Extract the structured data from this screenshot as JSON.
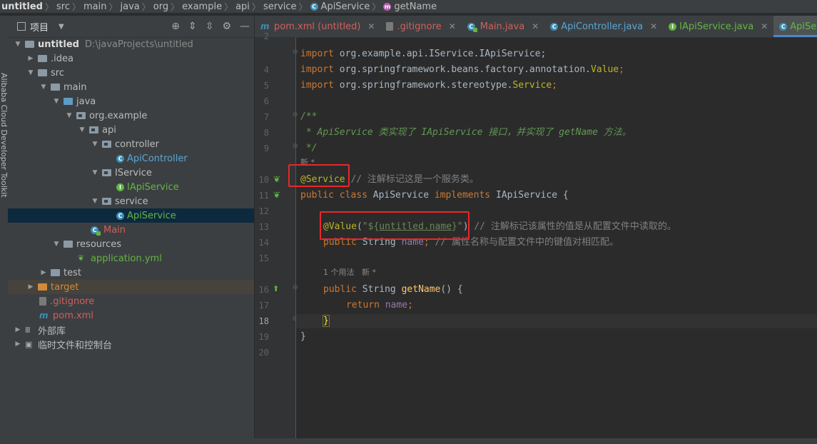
{
  "breadcrumb": {
    "project": "untitled",
    "items": [
      "src",
      "main",
      "java",
      "org",
      "example",
      "api",
      "service"
    ],
    "class_name": "ApiService",
    "method_name": "getName"
  },
  "left_strip": {
    "label": "Alibaba Cloud Developer Toolkit"
  },
  "project_panel": {
    "title": "项目",
    "tree": {
      "root_name": "untitled",
      "root_path": "D:\\javaProjects\\untitled",
      "idea": ".idea",
      "src": "src",
      "main": "main",
      "java": "java",
      "org_example": "org.example",
      "api": "api",
      "controller": "controller",
      "api_controller": "ApiController",
      "iservice": "IService",
      "iapiservice": "IApiService",
      "service": "service",
      "apiservice": "ApiService",
      "main_class": "Main",
      "resources": "resources",
      "application_yml": "application.yml",
      "test": "test",
      "target": "target",
      "gitignore": ".gitignore",
      "pom": "pom.xml",
      "external_libs": "外部库",
      "scratches": "临时文件和控制台"
    }
  },
  "tabs": [
    {
      "label": "pom.xml (untitled)",
      "icon": "maven-icon"
    },
    {
      "label": ".gitignore",
      "icon": "gitignore-icon"
    },
    {
      "label": "Main.java",
      "icon": "main-class-icon"
    },
    {
      "label": "ApiController.java",
      "icon": "class-icon"
    },
    {
      "label": "IApiService.java",
      "icon": "interface-icon"
    },
    {
      "label": "ApiService.java",
      "icon": "class-icon",
      "active": true
    }
  ],
  "editor": {
    "line_numbers": [
      "2",
      "3",
      "4",
      "5",
      "6",
      "7",
      "8",
      "9",
      "10",
      "11",
      "12",
      "13",
      "14",
      "15",
      "16",
      "17",
      "18",
      "19",
      "20"
    ],
    "code": {
      "l3_kw": "import",
      "l3_rest": " org.example.api.IService.IApiService;",
      "l4_kw": "import",
      "l4_rest": " org.springframework.beans.factory.annotation.",
      "l4_ann": "Value",
      "l4_end": ";",
      "l5_kw": "import",
      "l5_rest": " org.springframework.stereotype.",
      "l5_ann": "Service",
      "l5_end": ";",
      "l7": "/**",
      "l8": " * ApiService 类实现了 IApiService 接口，并实现了 getName 方法。",
      "l9": " */",
      "inlay_new": "新 *",
      "l10_ann": "@Service",
      "l10_cmt": " // 注解标记这是一个服务类。",
      "l11_kw1": "public class",
      "l11_name": " ApiService ",
      "l11_kw2": "implements",
      "l11_rest": " IApiService {",
      "l13_ann": "@Value",
      "l13_open": "(",
      "l13_str1": "\"${",
      "l13_str2": "untitled.name",
      "l13_str3": "}\"",
      "l13_close": ")",
      "l13_cmt": " // 注解标记该属性的值是从配置文件中读取的。",
      "l14_kw": "public",
      "l14_type": " String ",
      "l14_fld": "name",
      "l14_semi": ";",
      "l14_cmt": " // 属性名称与配置文件中的键值对相匹配。",
      "inlay_usage": "1 个用法   新 *",
      "l16_kw": "public",
      "l16_type": " String ",
      "l16_fn": "getName",
      "l16_rest": "() {",
      "l17_kw": "return",
      "l17_fld": " name",
      "l17_semi": ";",
      "l18": "}",
      "l19": "}"
    }
  },
  "colors": {
    "highlight_box": "#e8282a",
    "keyword": "#cc7832",
    "annotation": "#bbb529",
    "string": "#6a8759",
    "field": "#9876aa"
  }
}
